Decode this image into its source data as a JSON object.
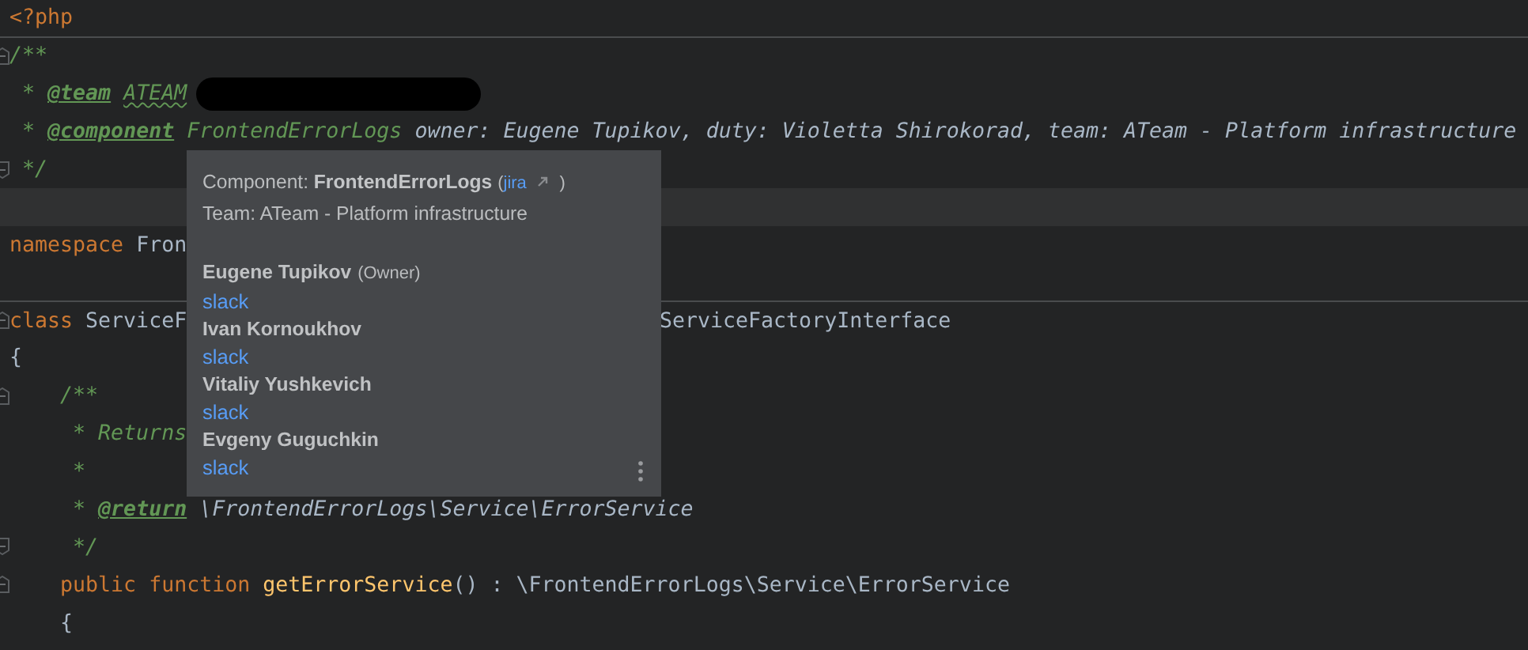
{
  "editor": {
    "lines": [
      {
        "current": false,
        "separator_after": true,
        "fold_start": false,
        "fold_end": false,
        "tokens": [
          {
            "kind": "keyword",
            "text": "<?php"
          }
        ]
      },
      {
        "current": false,
        "separator_after": false,
        "fold_start": true,
        "fold_end": false,
        "tokens": [
          {
            "kind": "comment",
            "text": "/**"
          }
        ]
      },
      {
        "current": false,
        "separator_after": false,
        "fold_start": false,
        "fold_end": false,
        "tokens": [
          {
            "kind": "comment",
            "text": " * "
          },
          {
            "kind": "doctag",
            "text": "@team"
          },
          {
            "kind": "typo",
            "text": "ATEAM"
          },
          {
            "kind": "redacted"
          }
        ]
      },
      {
        "current": false,
        "separator_after": false,
        "fold_start": false,
        "fold_end": false,
        "tokens": [
          {
            "kind": "comment",
            "text": " * "
          },
          {
            "kind": "doctag",
            "text": "@component"
          },
          {
            "kind": "comment",
            "text": " FrontendErrorLogs"
          },
          {
            "kind": "doctext",
            "text": " owner: Eugene Tupikov, duty: Violetta Shirokorad, team: ATeam - Platform infrastructure"
          }
        ]
      },
      {
        "current": false,
        "separator_after": false,
        "fold_start": false,
        "fold_end": true,
        "tokens": [
          {
            "kind": "comment",
            "text": " */"
          }
        ]
      },
      {
        "current": true,
        "separator_after": false,
        "fold_start": false,
        "fold_end": false
      },
      {
        "current": false,
        "separator_after": false,
        "fold_start": false,
        "fold_end": false,
        "tokens": [
          {
            "kind": "keyword",
            "text": "namespace"
          },
          {
            "kind": "plain",
            "text": " Fron"
          }
        ]
      },
      {
        "current": false,
        "separator_after": true,
        "fold_start": false,
        "fold_end": false
      },
      {
        "current": false,
        "separator_after": false,
        "fold_start": true,
        "fold_end": false,
        "tokens": [
          {
            "kind": "keyword",
            "text": "class"
          },
          {
            "kind": "plain",
            "text": " ServiceF"
          }
        ],
        "after_popup": "ServiceFactoryInterface"
      },
      {
        "current": false,
        "separator_after": false,
        "fold_start": false,
        "fold_end": false,
        "tokens": [
          {
            "kind": "plain",
            "text": "{"
          }
        ]
      },
      {
        "current": false,
        "separator_after": false,
        "fold_start": true,
        "fold_end": false,
        "tokens": [
          {
            "kind": "comment",
            "text": "    /**"
          }
        ]
      },
      {
        "current": false,
        "separator_after": false,
        "fold_start": false,
        "fold_end": false,
        "tokens": [
          {
            "kind": "comment",
            "text": "     * Returns"
          }
        ]
      },
      {
        "current": false,
        "separator_after": false,
        "fold_start": false,
        "fold_end": false,
        "tokens": [
          {
            "kind": "comment",
            "text": "     *"
          }
        ]
      },
      {
        "current": false,
        "separator_after": false,
        "fold_start": false,
        "fold_end": false,
        "tokens": [
          {
            "kind": "comment",
            "text": "     * "
          },
          {
            "kind": "doctag",
            "text": "@return"
          },
          {
            "kind": "doctext",
            "text": " \\FrontendErrorLogs\\Service\\ErrorService"
          }
        ]
      },
      {
        "current": false,
        "separator_after": false,
        "fold_start": false,
        "fold_end": true,
        "tokens": [
          {
            "kind": "comment",
            "text": "     */"
          }
        ]
      },
      {
        "current": false,
        "separator_after": false,
        "fold_start": true,
        "fold_end": false,
        "tokens": [
          {
            "kind": "keyword",
            "text": "    public"
          },
          {
            "kind": "keyword",
            "text": " function"
          },
          {
            "kind": "function",
            "text": " getErrorService"
          },
          {
            "kind": "plain",
            "text": "() : \\FrontendErrorLogs\\Service\\ErrorService"
          }
        ]
      },
      {
        "current": false,
        "separator_after": false,
        "fold_start": false,
        "fold_end": false,
        "tokens": [
          {
            "kind": "plain",
            "text": "    {"
          }
        ]
      }
    ]
  },
  "popup": {
    "component_label": "Component:",
    "component_name": "FrontendErrorLogs",
    "link_open": "(",
    "link": "jira",
    "link_close": ")",
    "team": "Team: ATeam - Platform infrastructure",
    "people": [
      {
        "name": "Eugene Tupikov",
        "role": "(Owner)",
        "link": "slack"
      },
      {
        "name": "Ivan Kornoukhov",
        "link": "slack"
      },
      {
        "name": "Vitaliy Yushkevich",
        "link": "slack"
      },
      {
        "name": "Evgeny Guguchkin",
        "link": "slack"
      }
    ]
  }
}
